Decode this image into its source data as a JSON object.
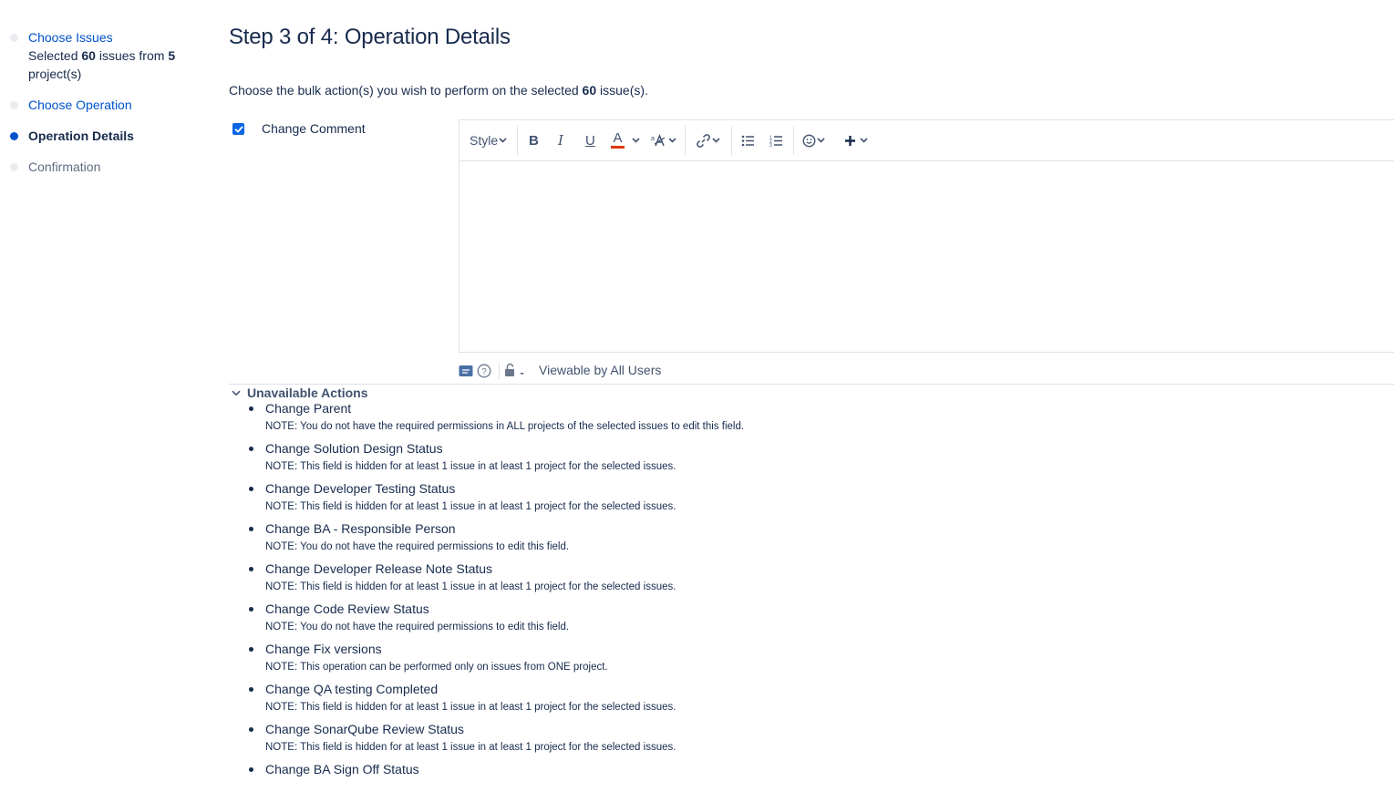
{
  "steps": {
    "choose_issues": {
      "label": "Choose Issues",
      "summary_pre": "Selected ",
      "issue_count": "60",
      "summary_mid": " issues from ",
      "project_count": "5",
      "summary_post": "project(s)"
    },
    "choose_operation": {
      "label": "Choose Operation"
    },
    "operation_details": {
      "label": "Operation Details"
    },
    "confirmation": {
      "label": "Confirmation"
    }
  },
  "main": {
    "title": "Step 3 of 4: Operation Details",
    "intro_pre": "Choose the bulk action(s) you wish to perform on the selected ",
    "intro_count": "60",
    "intro_post": " issue(s).",
    "change_comment_label": "Change Comment",
    "change_comment_checked": true
  },
  "editor": {
    "style_label": "Style",
    "bold": "B",
    "italic": "I",
    "underline": "U",
    "text_color": "A",
    "accent_color": "#de350b",
    "viewable_label": "Viewable by All Users"
  },
  "unavailable": {
    "heading": "Unavailable Actions",
    "items": [
      {
        "name": "Change Parent",
        "note": "NOTE: You do not have the required permissions in ALL projects of the selected issues to edit this field."
      },
      {
        "name": "Change Solution Design Status",
        "note": "NOTE: This field is hidden for at least 1 issue in at least 1 project for the selected issues."
      },
      {
        "name": "Change Developer Testing Status",
        "note": "NOTE: This field is hidden for at least 1 issue in at least 1 project for the selected issues."
      },
      {
        "name": "Change BA - Responsible Person",
        "note": "NOTE: You do not have the required permissions to edit this field."
      },
      {
        "name": "Change Developer Release Note Status",
        "note": "NOTE: This field is hidden for at least 1 issue in at least 1 project for the selected issues."
      },
      {
        "name": "Change Code Review Status",
        "note": "NOTE: You do not have the required permissions to edit this field."
      },
      {
        "name": "Change Fix versions",
        "note": "NOTE: This operation can be performed only on issues from ONE project."
      },
      {
        "name": "Change QA testing Completed",
        "note": "NOTE: This field is hidden for at least 1 issue in at least 1 project for the selected issues."
      },
      {
        "name": "Change SonarQube Review Status",
        "note": "NOTE: This field is hidden for at least 1 issue in at least 1 project for the selected issues."
      },
      {
        "name": "Change BA Sign Off Status",
        "note": ""
      }
    ]
  }
}
